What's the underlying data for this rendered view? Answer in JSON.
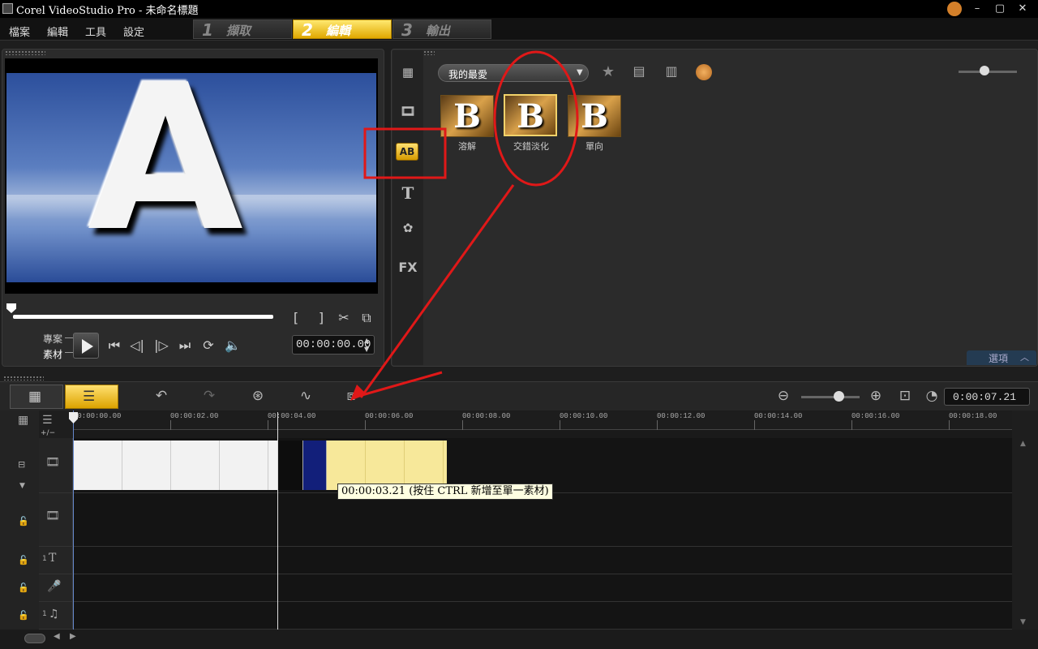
{
  "window": {
    "title": "Corel VideoStudio Pro - 未命名標題",
    "minimize": "–",
    "maximize": "▢",
    "close": "✕"
  },
  "menu": {
    "file": "檔案",
    "edit": "編輯",
    "tools": "工具",
    "settings": "設定"
  },
  "steps": [
    {
      "num": "1",
      "label": "擷取"
    },
    {
      "num": "2",
      "label": "編輯"
    },
    {
      "num": "3",
      "label": "輸出"
    }
  ],
  "preview": {
    "letter": "A",
    "mark_in": "[",
    "mark_out": "]",
    "project_label": "專案",
    "clip_label": "素材",
    "timecode": "00:00:00.00"
  },
  "library": {
    "category": "我的最愛",
    "transitions": [
      {
        "letter": "B",
        "label": "溶解"
      },
      {
        "letter": "B",
        "label": "交錯淡化"
      },
      {
        "letter": "B",
        "label": "單向"
      }
    ],
    "options_label": "選項",
    "side_fx": "FX"
  },
  "timeline": {
    "duration": "0:00:07.21",
    "ruler": [
      "00:00:00.00",
      "00:00:02.00",
      "00:00:04.00",
      "00:00:06.00",
      "00:00:08.00",
      "00:00:10.00",
      "00:00:12.00",
      "00:00:14.00",
      "00:00:16.00",
      "00:00:18.00"
    ],
    "tooltip": "00:00:03.21 (按住 CTRL 新增至單一素材)",
    "add_remove": "+/−",
    "track_badge": "1"
  },
  "colors": {
    "accent_yellow": "#f0c020",
    "annotation_red": "#e01818",
    "clip_yellow": "#f7e89a",
    "clip_white": "#f2f2f2",
    "transition_blue": "#121f7a"
  }
}
